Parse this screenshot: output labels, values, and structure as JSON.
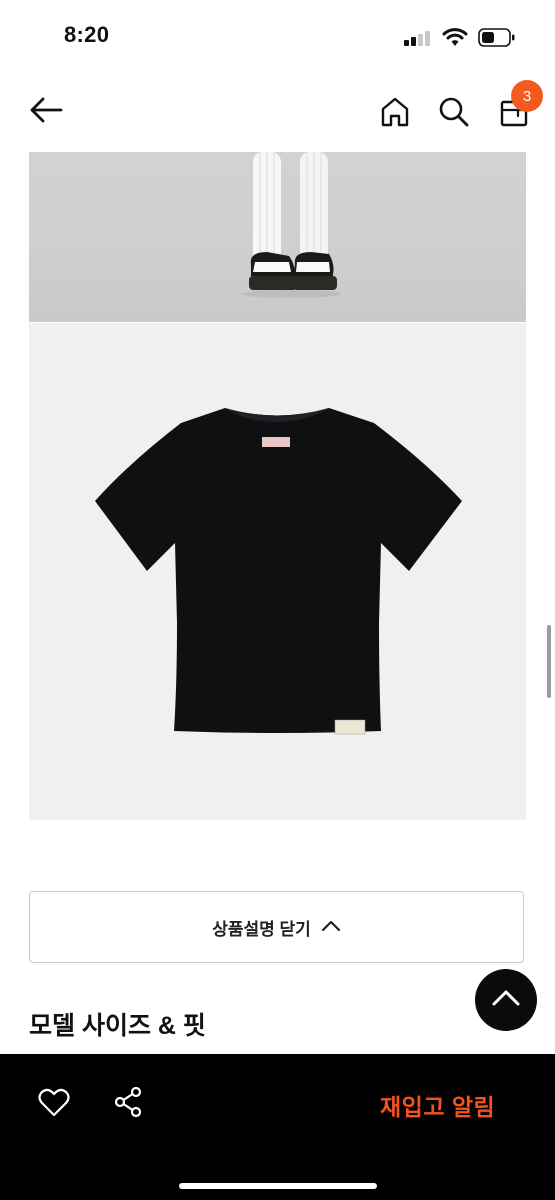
{
  "status_bar": {
    "time": "8:20"
  },
  "nav": {
    "back_icon": "arrow-left-icon",
    "home_icon": "home-icon",
    "search_icon": "search-icon",
    "cart_icon": "shopping-bag-icon",
    "cart_count": "3",
    "badge_color": "#f35b1e"
  },
  "product": {
    "photos": [
      "model-legs-photo",
      "black-tshirt-photo"
    ]
  },
  "description": {
    "collapse_label": "상품설명 닫기",
    "collapse_icon": "chevron-up-icon"
  },
  "sections": {
    "model_fit_heading": "모델 사이즈 & 핏"
  },
  "bottom_bar": {
    "wishlist_icon": "heart-icon",
    "share_icon": "share-icon",
    "restock_label": "재입고 알림",
    "accent_color": "#f4531d"
  }
}
